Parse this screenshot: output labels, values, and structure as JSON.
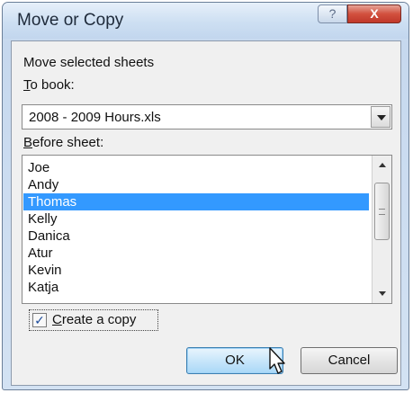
{
  "dialog": {
    "title": "Move or Copy",
    "help_glyph": "?",
    "close_glyph": "X"
  },
  "labels": {
    "move_selected": "Move selected sheets",
    "to_book_underlined": "T",
    "to_book_rest": "o book:",
    "before_sheet_underlined": "B",
    "before_sheet_rest": "efore sheet:"
  },
  "to_book": {
    "selected": "2008 - 2009 Hours.xls"
  },
  "before_sheet": {
    "items": [
      "Joe",
      "Andy",
      "Thomas",
      "Kelly",
      "Danica",
      "Atur",
      "Kevin",
      "Katja"
    ],
    "selected_index": 2
  },
  "create_copy": {
    "underlined": "C",
    "rest": "reate a copy",
    "checked": true
  },
  "buttons": {
    "ok": "OK",
    "cancel": "Cancel"
  },
  "colors": {
    "selection": "#3399ff",
    "close_button": "#c0382a"
  }
}
